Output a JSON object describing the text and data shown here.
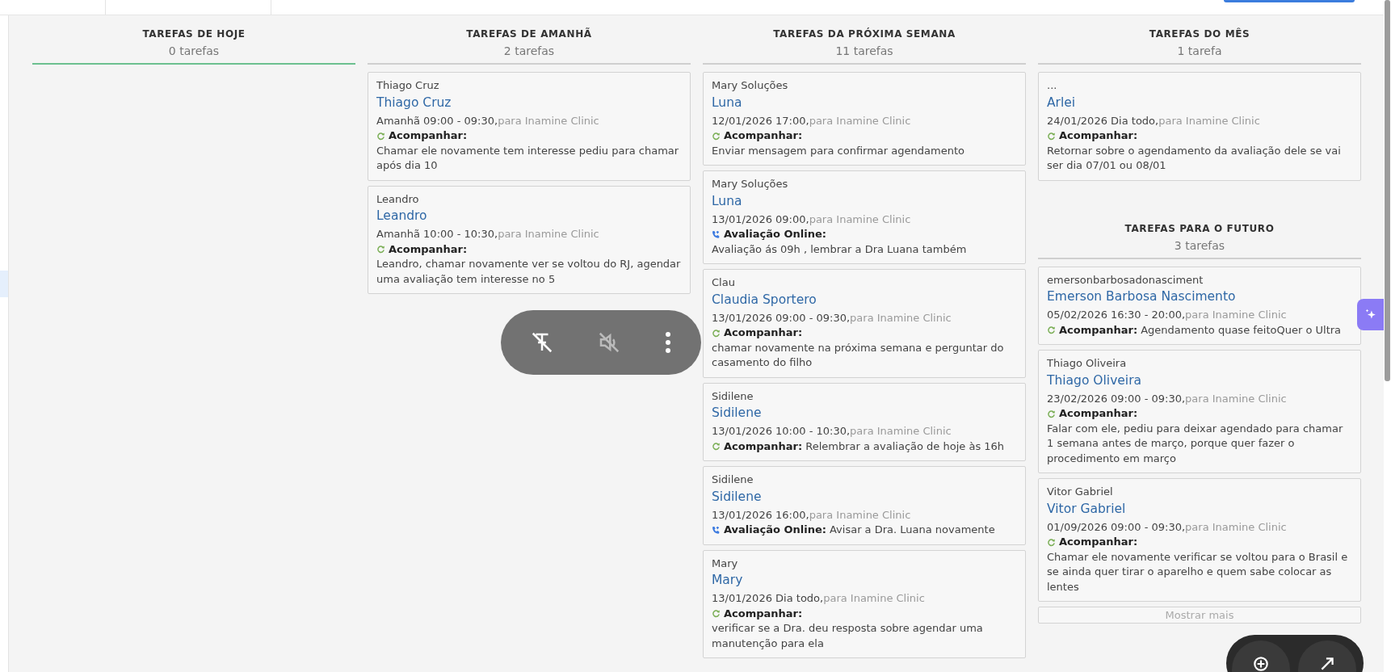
{
  "columns": [
    {
      "sections": [
        {
          "title": "TAREFAS DE HOJE",
          "count": "0 tarefas",
          "highlighted": true
        }
      ]
    },
    {
      "sections": [
        {
          "title": "TAREFAS DE AMANHÃ",
          "count": "2 tarefas",
          "highlighted": false,
          "cards": [
            {
              "owner": "Thiago Cruz",
              "name": "Thiago Cruz",
              "when": "Amanhã 09:00 - 09:30,",
              "target": "para Inamine Clinic",
              "action": {
                "kind": "follow",
                "label": "Acompanhar:"
              },
              "inline": false,
              "note": "Chamar ele novamente tem interesse pediu para chamar após dia 10"
            },
            {
              "owner": "Leandro",
              "name": "Leandro",
              "when": "Amanhã 10:00 - 10:30,",
              "target": "para Inamine Clinic",
              "action": {
                "kind": "follow",
                "label": "Acompanhar:"
              },
              "inline": false,
              "note": "Leandro, chamar novamente ver se voltou do RJ, agendar uma avaliação tem interesse no 5"
            }
          ]
        }
      ]
    },
    {
      "sections": [
        {
          "title": "TAREFAS DA PRÓXIMA SEMANA",
          "count": "11 tarefas",
          "highlighted": false,
          "cards": [
            {
              "owner": "Mary Soluções",
              "name": "Luna",
              "when": "12/01/2026 17:00,",
              "target": "para Inamine Clinic",
              "action": {
                "kind": "follow",
                "label": "Acompanhar:"
              },
              "inline": false,
              "note": "Enviar mensagem para confirmar agendamento"
            },
            {
              "owner": "Mary Soluções",
              "name": "Luna",
              "when": "13/01/2026 09:00,",
              "target": "para Inamine Clinic",
              "action": {
                "kind": "call",
                "label": "Avaliação Online:"
              },
              "inline": false,
              "note": "Avaliação ás 09h , lembrar a Dra Luana também"
            },
            {
              "owner": "Clau",
              "name": "Claudia Sportero",
              "when": "13/01/2026 09:00 - 09:30,",
              "target": "para Inamine Clinic",
              "action": {
                "kind": "follow",
                "label": "Acompanhar:"
              },
              "inline": false,
              "note": "chamar novamente na próxima semana e perguntar do casamento do filho"
            },
            {
              "owner": "Sidilene",
              "name": "Sidilene",
              "when": "13/01/2026 10:00 - 10:30,",
              "target": "para Inamine Clinic",
              "action": {
                "kind": "follow",
                "label": "Acompanhar:"
              },
              "inline": true,
              "note": "Relembrar a avaliação de hoje às 16h"
            },
            {
              "owner": "Sidilene",
              "name": "Sidilene",
              "when": "13/01/2026 16:00,",
              "target": "para Inamine Clinic",
              "action": {
                "kind": "call",
                "label": "Avaliação Online:"
              },
              "inline": true,
              "note": "Avisar a Dra. Luana novamente"
            },
            {
              "owner": "Mary",
              "name": "Mary",
              "when": "13/01/2026 Dia todo,",
              "target": "para Inamine Clinic",
              "action": {
                "kind": "follow",
                "label": "Acompanhar:"
              },
              "inline": false,
              "note": "verificar se a Dra. deu resposta sobre agendar uma manutenção para ela"
            }
          ]
        }
      ]
    },
    {
      "sections": [
        {
          "title": "TAREFAS DO MÊS",
          "count": "1 tarefa",
          "highlighted": false,
          "cards": [
            {
              "owner": "...",
              "name": "Arlei",
              "when": "24/01/2026 Dia todo,",
              "target": "para Inamine Clinic",
              "action": {
                "kind": "follow",
                "label": "Acompanhar:"
              },
              "inline": false,
              "note": "Retornar sobre o agendamento da avaliação dele se vai ser dia 07/01 ou 08/01"
            }
          ]
        },
        {
          "title": "TAREFAS PARA O FUTURO",
          "count": "3 tarefas",
          "highlighted": false,
          "more": "Mostrar mais",
          "cards": [
            {
              "owner": "emersonbarbosadonasciment",
              "name": "Emerson Barbosa Nascimento",
              "when": "05/02/2026 16:30 - 20:00,",
              "target": "para Inamine Clinic",
              "action": {
                "kind": "follow",
                "label": "Acompanhar:"
              },
              "inline": true,
              "note": "Agendamento quase feitoQuer o Ultra"
            },
            {
              "owner": "Thiago Oliveira",
              "name": "Thiago Oliveira",
              "when": "23/02/2026 09:00 - 09:30,",
              "target": "para Inamine Clinic",
              "action": {
                "kind": "follow",
                "label": "Acompanhar:"
              },
              "inline": false,
              "note": "Falar com ele, pediu para deixar agendado para chamar 1 semana antes de março, porque quer fazer o procedimento em março"
            },
            {
              "owner": "Vitor Gabriel",
              "name": "Vitor Gabriel",
              "when": "01/09/2026 09:00 - 09:30,",
              "target": "para Inamine Clinic",
              "action": {
                "kind": "follow",
                "label": "Acompanhar:"
              },
              "inline": false,
              "note": "Chamar ele novamente verificar se voltou para o Brasil e se ainda quer tirar o aparelho e quem sabe colocar as lentes"
            }
          ]
        }
      ]
    }
  ]
}
